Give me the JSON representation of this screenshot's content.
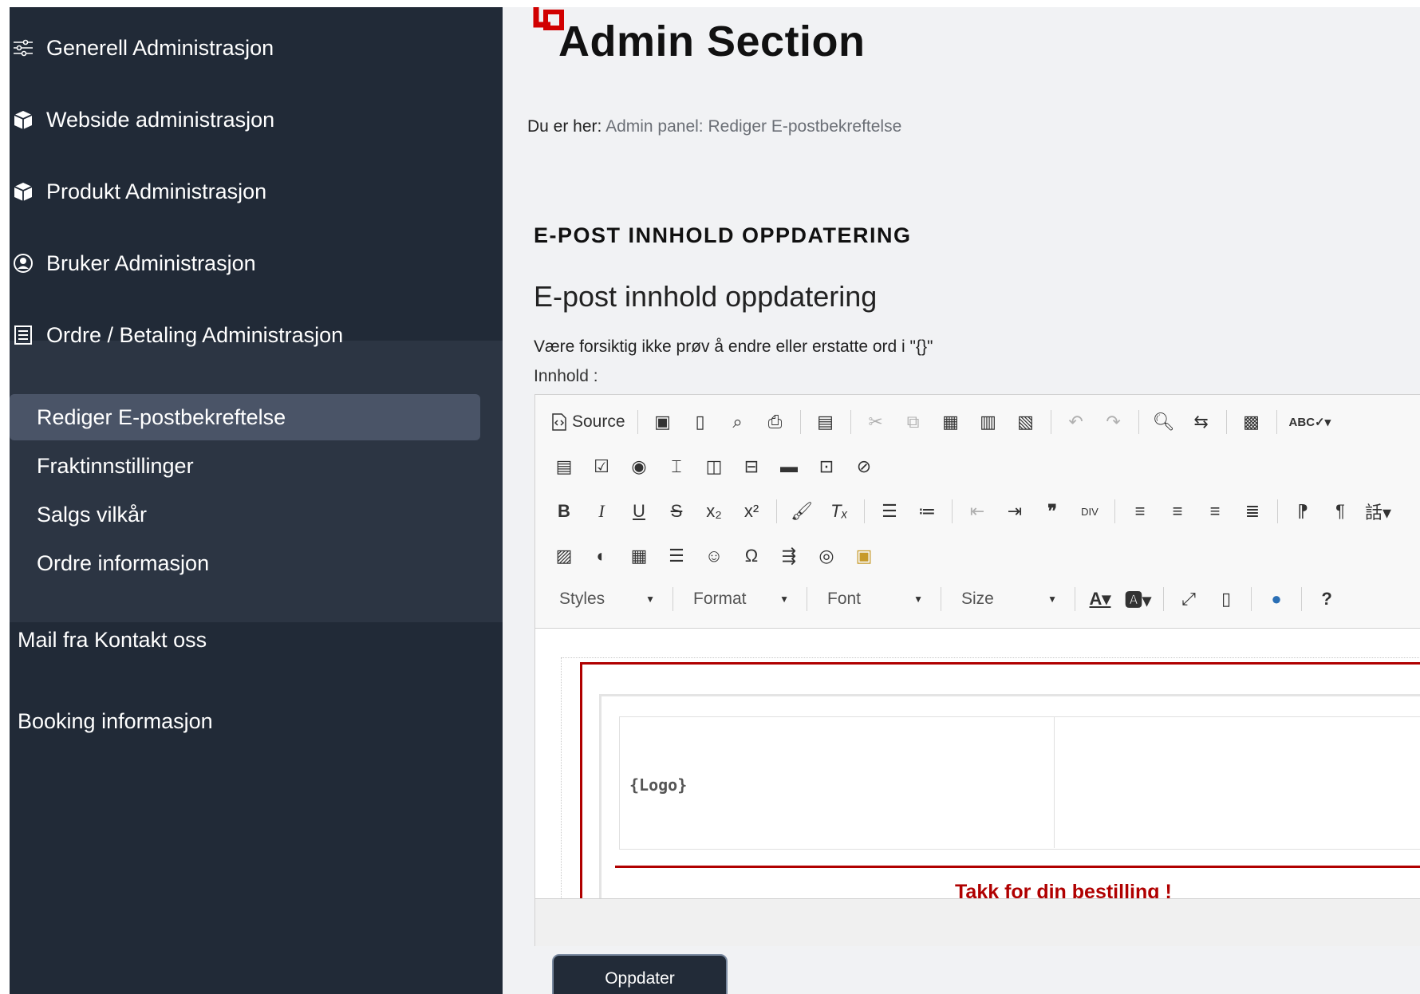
{
  "sidebar": {
    "items": [
      {
        "label": "Generell Administrasjon",
        "icon": "sliders-icon"
      },
      {
        "label": "Webside administrasjon",
        "icon": "box-icon"
      },
      {
        "label": "Produkt Administrasjon",
        "icon": "box-icon"
      },
      {
        "label": "Bruker Administrasjon",
        "icon": "user-circle-icon"
      },
      {
        "label": "Ordre / Betaling Administrasjon",
        "icon": "receipt-icon"
      }
    ],
    "subitems": [
      {
        "label": "Rediger E-postbekreftelse",
        "active": true
      },
      {
        "label": "Fraktinnstillinger",
        "active": false
      },
      {
        "label": "Salgs vilkår",
        "active": false
      },
      {
        "label": "Ordre informasjon",
        "active": false
      }
    ],
    "plain_items": [
      {
        "label": "Mail fra Kontakt oss"
      },
      {
        "label": "Booking informasjon"
      }
    ]
  },
  "header": {
    "title": "Admin Section"
  },
  "breadcrumb": {
    "prefix": "Du er her:",
    "path": "Admin panel: Rediger E-postbekreftelse"
  },
  "main": {
    "section_caps": "E-POST INNHOLD OPPDATERING",
    "section_title": "E-post innhold oppdatering",
    "warning": "Være forsiktig ikke prøv å endre eller erstatte ord i \"{}\"",
    "content_label": "Innhold :"
  },
  "editor": {
    "source_label": "Source",
    "combos": {
      "styles": "Styles",
      "format": "Format",
      "font": "Font",
      "size": "Size"
    },
    "content": {
      "logo_token": "{Logo}",
      "thanks_text": "Takk for din bestilling !"
    }
  },
  "actions": {
    "update_label": "Oppdater"
  },
  "colors": {
    "sidebar_bg": "#212a37",
    "sidebar_group_bg": "#2c3543",
    "active_bg": "#4a5467",
    "accent_red": "#b00000"
  }
}
